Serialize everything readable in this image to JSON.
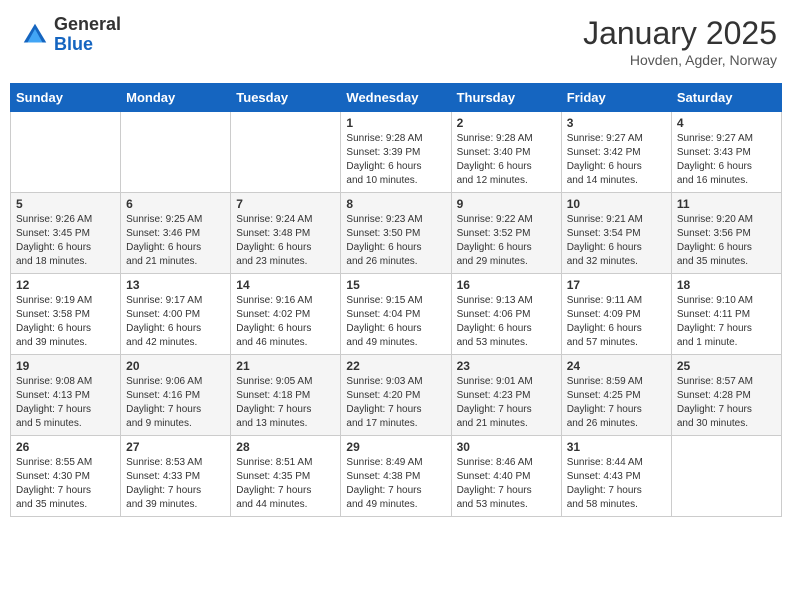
{
  "header": {
    "logo_general": "General",
    "logo_blue": "Blue",
    "month_title": "January 2025",
    "location": "Hovden, Agder, Norway"
  },
  "weekdays": [
    "Sunday",
    "Monday",
    "Tuesday",
    "Wednesday",
    "Thursday",
    "Friday",
    "Saturday"
  ],
  "weeks": [
    [
      {
        "day": "",
        "info": ""
      },
      {
        "day": "",
        "info": ""
      },
      {
        "day": "",
        "info": ""
      },
      {
        "day": "1",
        "info": "Sunrise: 9:28 AM\nSunset: 3:39 PM\nDaylight: 6 hours\nand 10 minutes."
      },
      {
        "day": "2",
        "info": "Sunrise: 9:28 AM\nSunset: 3:40 PM\nDaylight: 6 hours\nand 12 minutes."
      },
      {
        "day": "3",
        "info": "Sunrise: 9:27 AM\nSunset: 3:42 PM\nDaylight: 6 hours\nand 14 minutes."
      },
      {
        "day": "4",
        "info": "Sunrise: 9:27 AM\nSunset: 3:43 PM\nDaylight: 6 hours\nand 16 minutes."
      }
    ],
    [
      {
        "day": "5",
        "info": "Sunrise: 9:26 AM\nSunset: 3:45 PM\nDaylight: 6 hours\nand 18 minutes."
      },
      {
        "day": "6",
        "info": "Sunrise: 9:25 AM\nSunset: 3:46 PM\nDaylight: 6 hours\nand 21 minutes."
      },
      {
        "day": "7",
        "info": "Sunrise: 9:24 AM\nSunset: 3:48 PM\nDaylight: 6 hours\nand 23 minutes."
      },
      {
        "day": "8",
        "info": "Sunrise: 9:23 AM\nSunset: 3:50 PM\nDaylight: 6 hours\nand 26 minutes."
      },
      {
        "day": "9",
        "info": "Sunrise: 9:22 AM\nSunset: 3:52 PM\nDaylight: 6 hours\nand 29 minutes."
      },
      {
        "day": "10",
        "info": "Sunrise: 9:21 AM\nSunset: 3:54 PM\nDaylight: 6 hours\nand 32 minutes."
      },
      {
        "day": "11",
        "info": "Sunrise: 9:20 AM\nSunset: 3:56 PM\nDaylight: 6 hours\nand 35 minutes."
      }
    ],
    [
      {
        "day": "12",
        "info": "Sunrise: 9:19 AM\nSunset: 3:58 PM\nDaylight: 6 hours\nand 39 minutes."
      },
      {
        "day": "13",
        "info": "Sunrise: 9:17 AM\nSunset: 4:00 PM\nDaylight: 6 hours\nand 42 minutes."
      },
      {
        "day": "14",
        "info": "Sunrise: 9:16 AM\nSunset: 4:02 PM\nDaylight: 6 hours\nand 46 minutes."
      },
      {
        "day": "15",
        "info": "Sunrise: 9:15 AM\nSunset: 4:04 PM\nDaylight: 6 hours\nand 49 minutes."
      },
      {
        "day": "16",
        "info": "Sunrise: 9:13 AM\nSunset: 4:06 PM\nDaylight: 6 hours\nand 53 minutes."
      },
      {
        "day": "17",
        "info": "Sunrise: 9:11 AM\nSunset: 4:09 PM\nDaylight: 6 hours\nand 57 minutes."
      },
      {
        "day": "18",
        "info": "Sunrise: 9:10 AM\nSunset: 4:11 PM\nDaylight: 7 hours\nand 1 minute."
      }
    ],
    [
      {
        "day": "19",
        "info": "Sunrise: 9:08 AM\nSunset: 4:13 PM\nDaylight: 7 hours\nand 5 minutes."
      },
      {
        "day": "20",
        "info": "Sunrise: 9:06 AM\nSunset: 4:16 PM\nDaylight: 7 hours\nand 9 minutes."
      },
      {
        "day": "21",
        "info": "Sunrise: 9:05 AM\nSunset: 4:18 PM\nDaylight: 7 hours\nand 13 minutes."
      },
      {
        "day": "22",
        "info": "Sunrise: 9:03 AM\nSunset: 4:20 PM\nDaylight: 7 hours\nand 17 minutes."
      },
      {
        "day": "23",
        "info": "Sunrise: 9:01 AM\nSunset: 4:23 PM\nDaylight: 7 hours\nand 21 minutes."
      },
      {
        "day": "24",
        "info": "Sunrise: 8:59 AM\nSunset: 4:25 PM\nDaylight: 7 hours\nand 26 minutes."
      },
      {
        "day": "25",
        "info": "Sunrise: 8:57 AM\nSunset: 4:28 PM\nDaylight: 7 hours\nand 30 minutes."
      }
    ],
    [
      {
        "day": "26",
        "info": "Sunrise: 8:55 AM\nSunset: 4:30 PM\nDaylight: 7 hours\nand 35 minutes."
      },
      {
        "day": "27",
        "info": "Sunrise: 8:53 AM\nSunset: 4:33 PM\nDaylight: 7 hours\nand 39 minutes."
      },
      {
        "day": "28",
        "info": "Sunrise: 8:51 AM\nSunset: 4:35 PM\nDaylight: 7 hours\nand 44 minutes."
      },
      {
        "day": "29",
        "info": "Sunrise: 8:49 AM\nSunset: 4:38 PM\nDaylight: 7 hours\nand 49 minutes."
      },
      {
        "day": "30",
        "info": "Sunrise: 8:46 AM\nSunset: 4:40 PM\nDaylight: 7 hours\nand 53 minutes."
      },
      {
        "day": "31",
        "info": "Sunrise: 8:44 AM\nSunset: 4:43 PM\nDaylight: 7 hours\nand 58 minutes."
      },
      {
        "day": "",
        "info": ""
      }
    ]
  ]
}
